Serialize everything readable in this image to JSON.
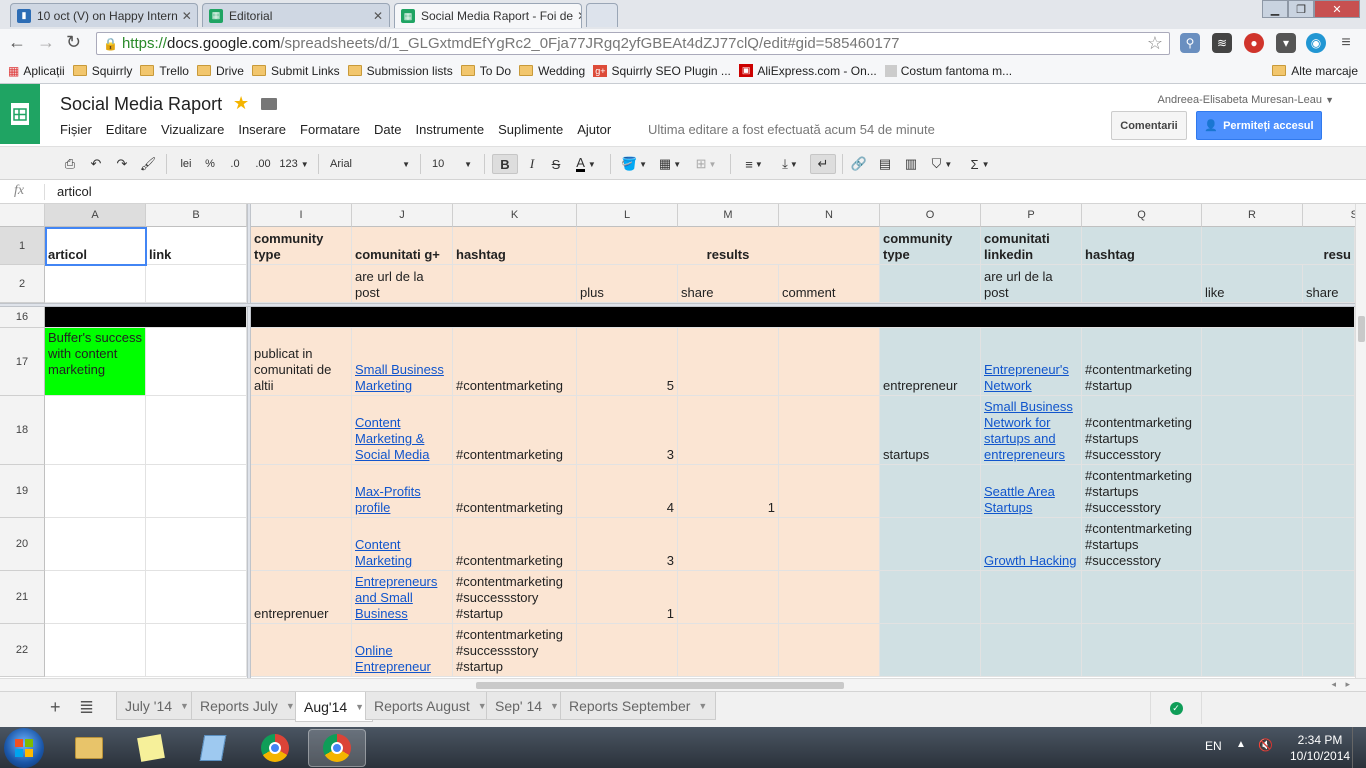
{
  "browser": {
    "tabs": [
      {
        "title": "10 oct (V) on Happy Intern",
        "color": "#2d6db5"
      },
      {
        "title": "Editorial",
        "color": "#1fa463"
      },
      {
        "title": "Social Media Raport - Foi de",
        "color": "#1fa463"
      }
    ],
    "url": {
      "scheme": "https://",
      "host": "docs.google.com",
      "path": "/spreadsheets/d/1_GLGxtmdEfYgRc2_0Fja77JRgq2yfGBEAt4dZJ77clQ/edit#gid=585460177"
    },
    "bookmarks": [
      "Aplicații",
      "Squirrly",
      "Trello",
      "Drive",
      "Submit Links",
      "Submission lists",
      "To Do",
      "Wedding",
      "Squirrly SEO Plugin ...",
      "AliExpress.com - On...",
      "Costum fantoma m...",
      "Alte marcaje"
    ]
  },
  "docs": {
    "title": "Social Media Raport",
    "menu": [
      "Fișier",
      "Editare",
      "Vizualizare",
      "Inserare",
      "Formatare",
      "Date",
      "Instrumente",
      "Suplimente",
      "Ajutor"
    ],
    "last_edit": "Ultima editare a fost efectuată acum 54 de minute",
    "user": "Andreea-Elisabeta Muresan-Leau",
    "comments_label": "Comentarii",
    "share_label": "Permiteți accesul"
  },
  "toolbar": {
    "font": "Arial",
    "size": "10",
    "format_num": "123",
    "percent": "%",
    "dec_less": ".0",
    "dec_more": ".00",
    "lei": "lei"
  },
  "formula": {
    "fx": "fx",
    "value": "articol"
  },
  "grid": {
    "columns": [
      "A",
      "B",
      "I",
      "J",
      "K",
      "L",
      "M",
      "N",
      "O",
      "P",
      "Q",
      "R",
      "S"
    ],
    "rows": [
      "1",
      "2",
      "16",
      "17",
      "18",
      "19",
      "20",
      "21",
      "22"
    ],
    "r1": {
      "A": "articol",
      "B": "link",
      "I": "community type",
      "J": "comunitati g+",
      "K": "hashtag",
      "L": "results",
      "O": "community type",
      "P": "comunitati linkedin",
      "Q": "hashtag",
      "R": "resu"
    },
    "r2": {
      "J": "are url de la post",
      "L": "plus",
      "M": "share",
      "N": "comment",
      "P": "are url de la post",
      "R": "like",
      "S": "share"
    },
    "r17": {
      "A": "Buffer's success with content marketing",
      "I": "publicat in comunitati de altii",
      "J": "Small Business Marketing",
      "K": "#contentmarketing",
      "L": "5",
      "O": "entrepreneur",
      "P": "Entrepreneur's Network",
      "Q": "#contentmarketing\n#startup"
    },
    "r18": {
      "J": "Content Marketing & Social Media",
      "K": "#contentmarketing",
      "L": "3",
      "O": "startups",
      "P": "Small Business Network for startups and entrepreneurs",
      "Q": "#contentmarketing\n#startups\n#successtory"
    },
    "r19": {
      "J": "Max-Profits profile",
      "K": "#contentmarketing",
      "L": "4",
      "M": "1",
      "P": "Seattle Area Startups",
      "Q": "#contentmarketing\n#startups\n#successtory"
    },
    "r20": {
      "J": "Content Marketing",
      "K": "#contentmarketing",
      "L": "3",
      "P": "Growth Hacking",
      "Q": "#contentmarketing\n#startups\n#successtory"
    },
    "r21": {
      "I": "entreprenuer",
      "J": "Entrepreneurs and Small Business",
      "K": "#contentmarketing\n#successstory\n#startup",
      "L": "1"
    },
    "r22": {
      "J": "Online Entrepreneur",
      "K": "#contentmarketing\n#successstory\n#startup"
    }
  },
  "sheets": [
    "July '14",
    "Reports July",
    "Aug'14",
    "Reports August",
    "Sep' 14",
    "Reports September"
  ],
  "active_sheet": "Aug'14",
  "taskbar": {
    "lang": "EN",
    "time": "2:34 PM",
    "date": "10/10/2014"
  },
  "colors": {
    "peach": "#fbe5d3",
    "blue_grey": "#d0e0e3",
    "green": "#00ff00",
    "accent": "#4d90fe"
  }
}
